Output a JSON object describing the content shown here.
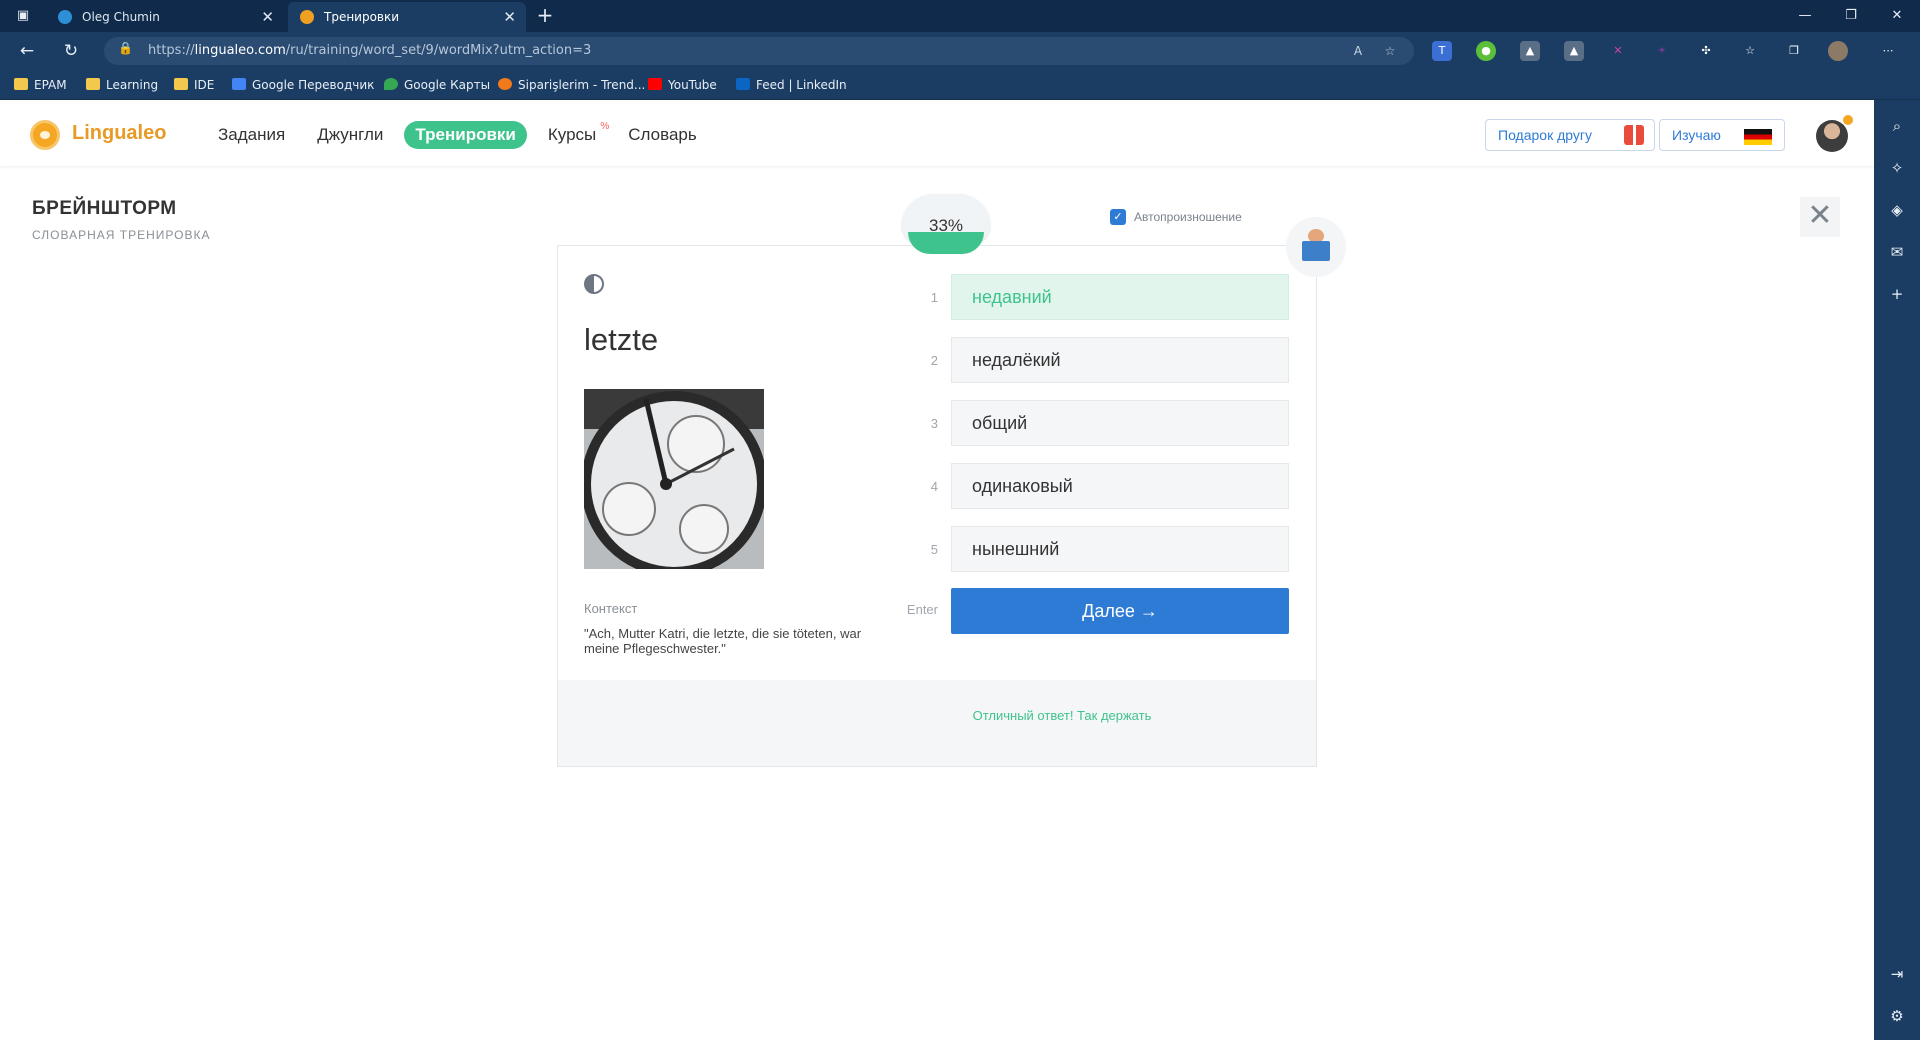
{
  "browser": {
    "tabs": [
      {
        "title": "Oleg Chumin",
        "close": "✕"
      },
      {
        "title": "Тренировки",
        "close": "✕"
      }
    ],
    "new_tab": "+",
    "window_buttons": [
      "—",
      "❐",
      "✕"
    ],
    "url_prefix": "https://",
    "url_host": "lingualeo.com",
    "url_path": "/ru/training/word_set/9/wordMix?utm_action=3",
    "bookmarks": [
      "EPAM",
      "Learning",
      "IDE",
      "Google Переводчик",
      "Google Карты",
      "Siparişlerim - Trend...",
      "YouTube",
      "Feed | LinkedIn"
    ]
  },
  "site": {
    "logo": "Lingualeo",
    "menu": [
      {
        "label": "Задания"
      },
      {
        "label": "Джунгли"
      },
      {
        "label": "Тренировки"
      },
      {
        "label": "Курсы",
        "badge": "%"
      },
      {
        "label": "Словарь"
      }
    ],
    "gift_button": "Подарок другу",
    "learning_button": "Изучаю"
  },
  "training": {
    "title": "БРЕЙНШТОРМ",
    "subtitle": "СЛОВАРНАЯ ТРЕНИРОВКА",
    "progress_label": "33%",
    "progress": 0.33,
    "autoplay_label": "Автопроизношение",
    "autoplay_checked": true,
    "word": "letzte",
    "context_label": "Контекст",
    "context_text": "\"Ach, Mutter Katri, die letzte, die sie töteten, war meine Pflegeschwester.\"",
    "options": [
      {
        "num": "1",
        "text": "недавний",
        "correct": true
      },
      {
        "num": "2",
        "text": "недалёкий"
      },
      {
        "num": "3",
        "text": "общий"
      },
      {
        "num": "4",
        "text": "одинаковый"
      },
      {
        "num": "5",
        "text": "нынешний"
      }
    ],
    "enter_label": "Enter",
    "next_button": "Далее →",
    "feedback": "Отличный ответ! Так держать",
    "close": "✕"
  },
  "colors": {
    "accent_green": "#3fc38d",
    "accent_blue": "#2e7bd6",
    "logo_orange": "#e89a26",
    "browser_dark": "#1c3d63"
  }
}
